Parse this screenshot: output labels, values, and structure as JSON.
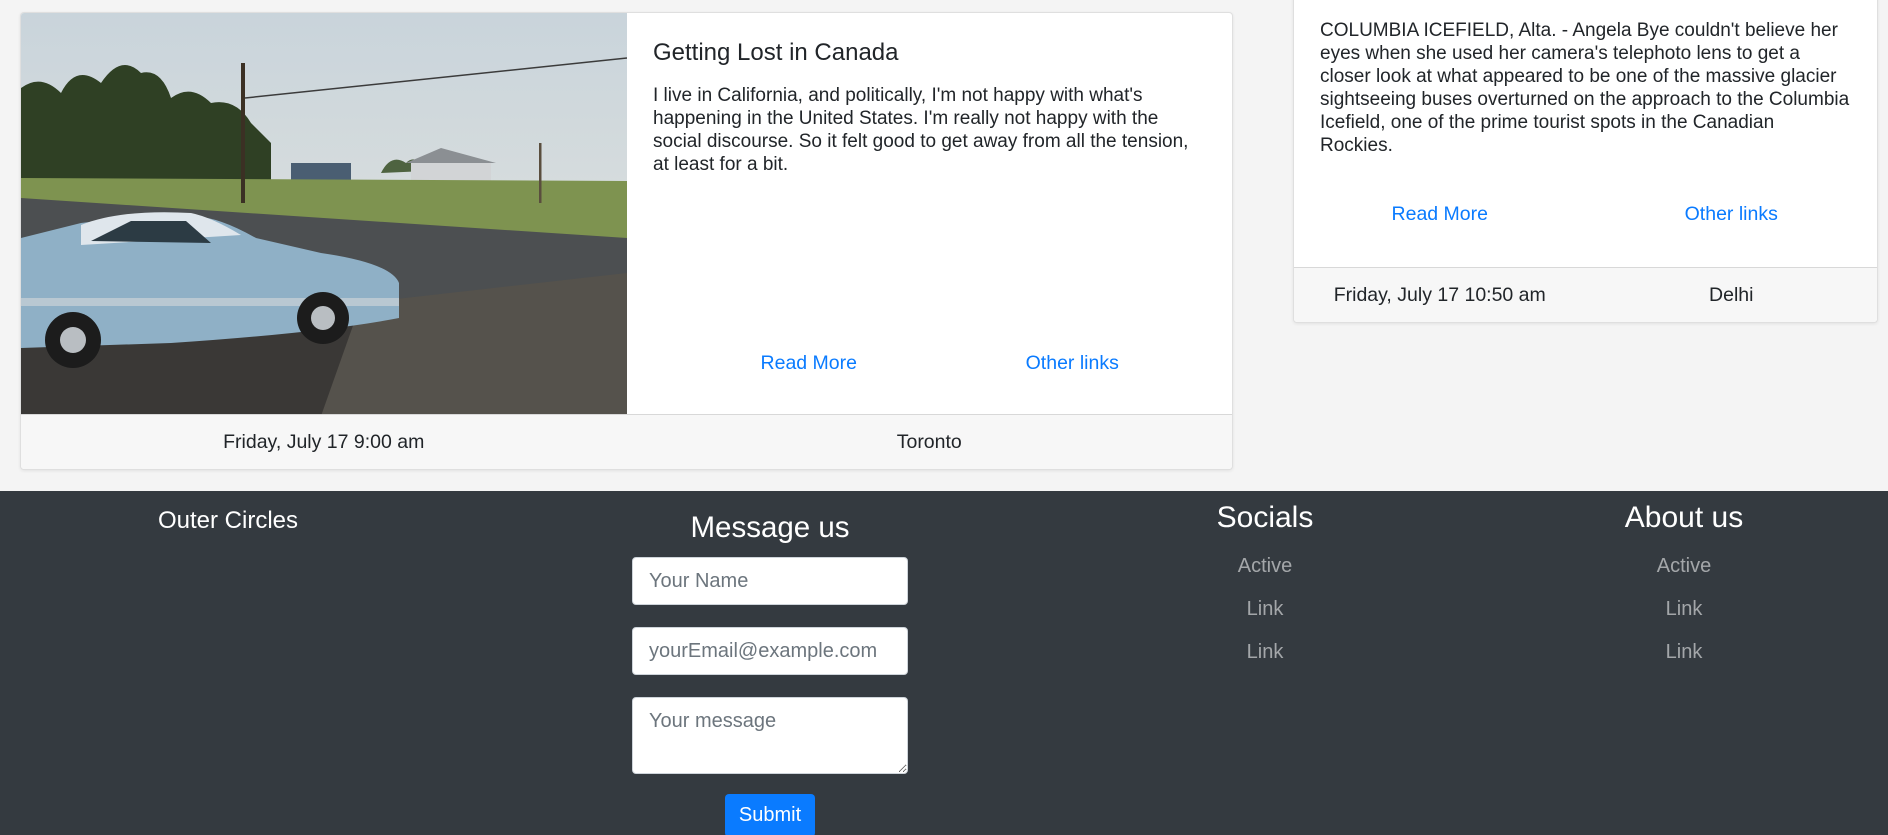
{
  "main_card": {
    "title": "Getting Lost in Canada",
    "text": "I live in California, and politically, I'm not happy with what's happening in the United States. I'm really not happy with the social discourse. So it felt good to get away from all the tension, at least for a bit.",
    "read_more": "Read More",
    "other_links": "Other links",
    "date": "Friday, July 17 9:00 am",
    "location": "Toronto"
  },
  "side_card": {
    "text": "COLUMBIA ICEFIELD, Alta. - Angela Bye couldn't believe her eyes when she used her camera's telephoto lens to get a closer look at what appeared to be one of the massive glacier sightseeing buses overturned on the approach to the Columbia Icefield, one of the prime tourist spots in the Canadian Rockies.",
    "read_more": "Read More",
    "other_links": "Other links",
    "date": "Friday, July 17 10:50 am",
    "location": "Delhi"
  },
  "footer": {
    "brand": "Outer Circles",
    "message_title": "Message us",
    "name_placeholder": "Your Name",
    "email_placeholder": "yourEmail@example.com",
    "message_placeholder": "Your message",
    "submit_label": "Submit",
    "socials": {
      "title": "Socials",
      "links": [
        "Active",
        "Link",
        "Link"
      ]
    },
    "about": {
      "title": "About us",
      "links": [
        "Active",
        "Link",
        "Link"
      ]
    }
  }
}
